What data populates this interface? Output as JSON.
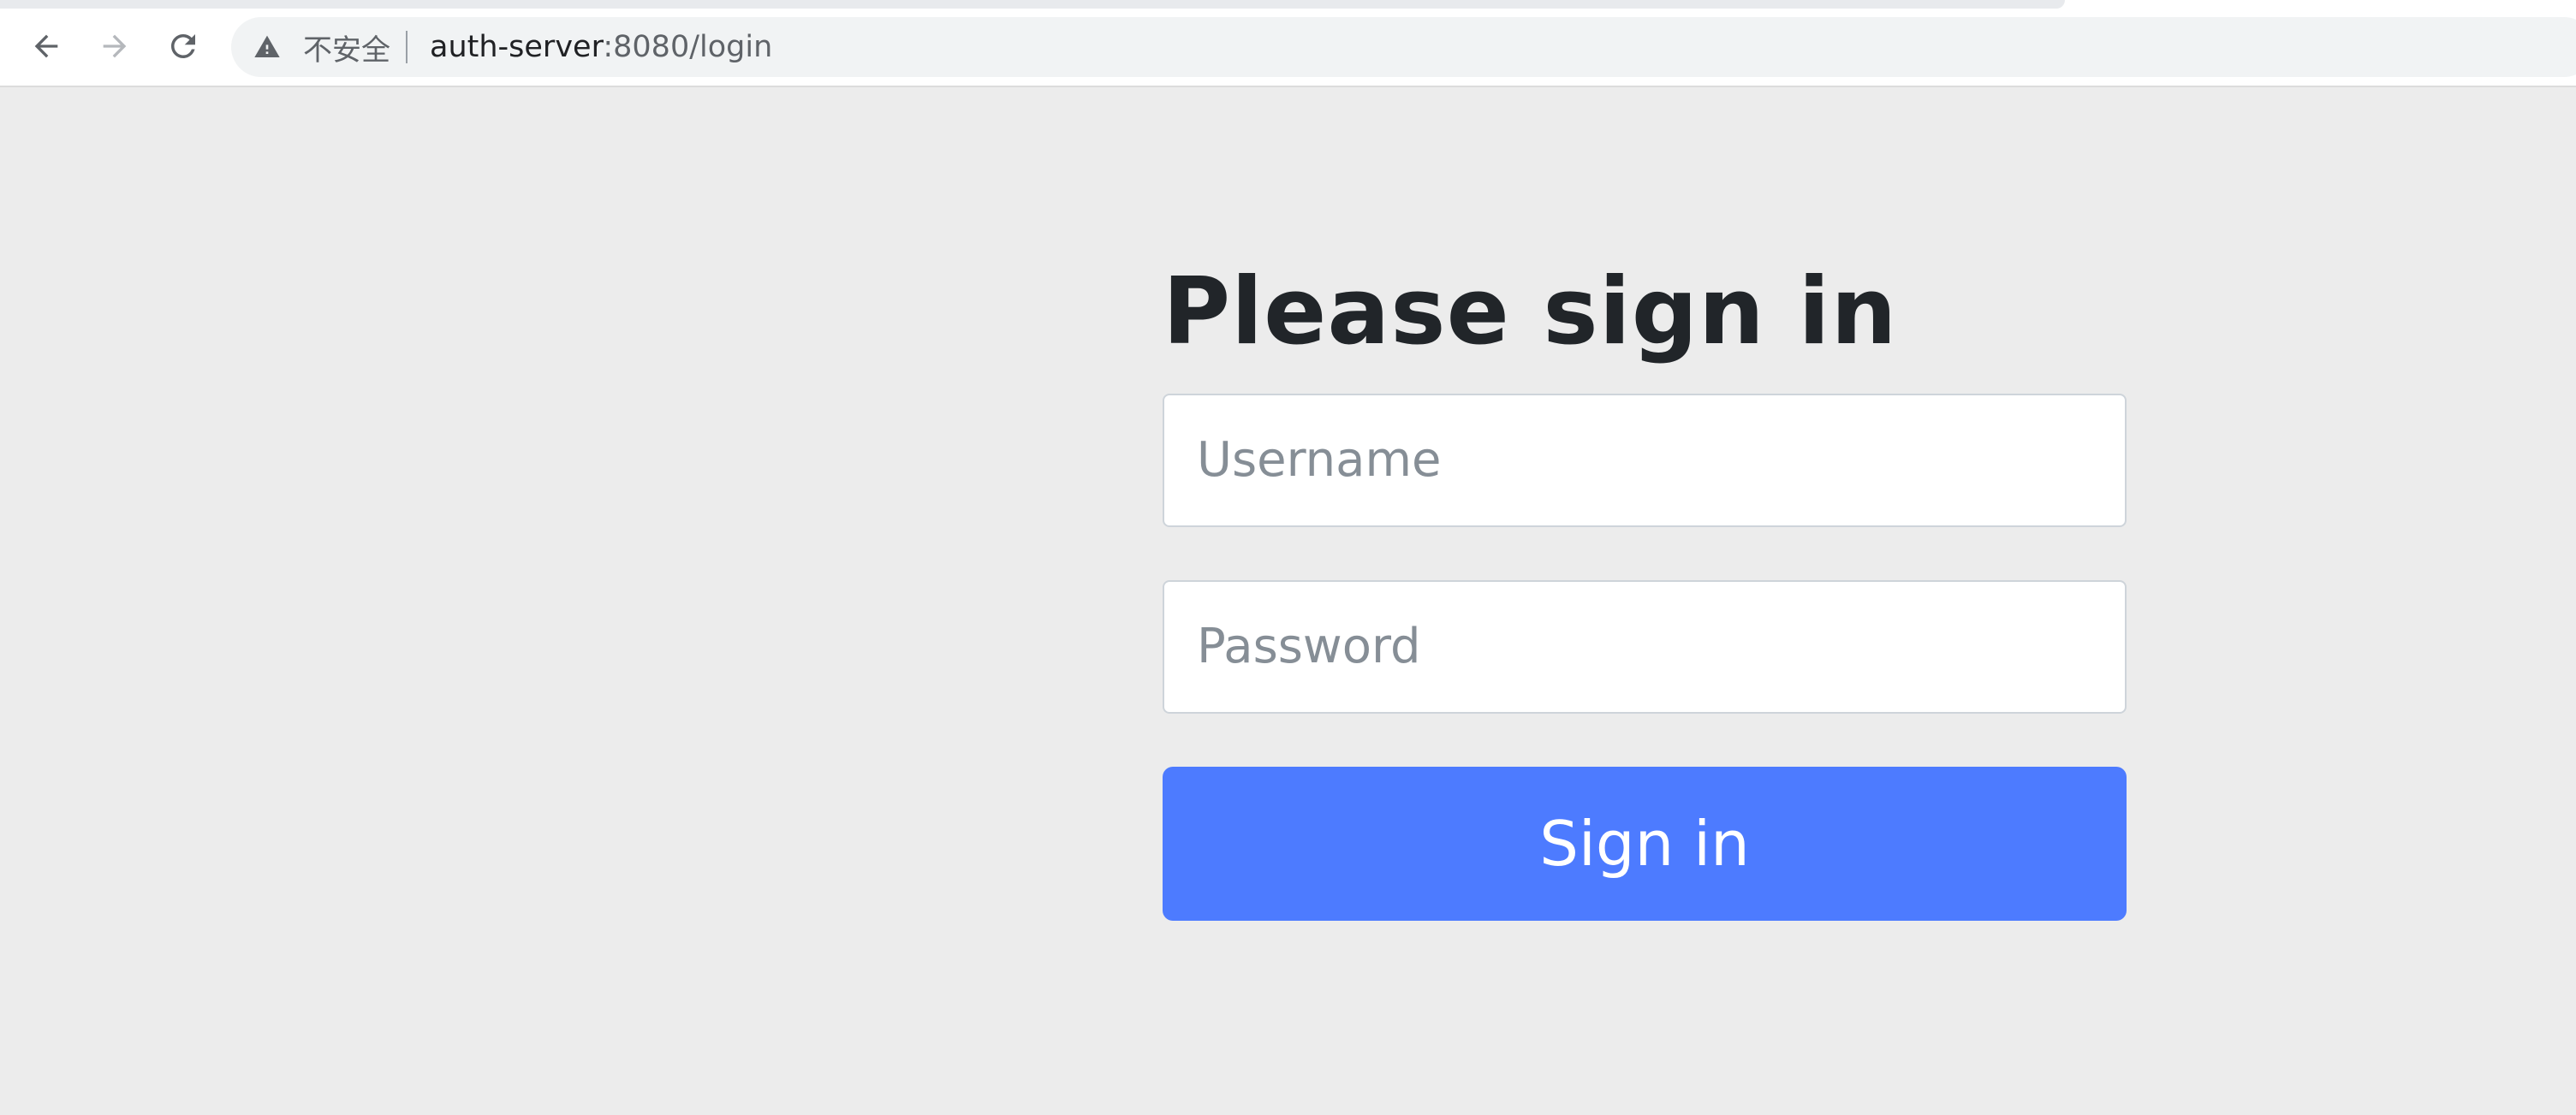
{
  "browser": {
    "security_label": "不安全",
    "url_host": "auth-server",
    "url_rest": ":8080/login",
    "icons": {
      "back": "arrow-left-icon",
      "forward": "arrow-right-icon",
      "reload": "reload-icon",
      "security": "warning-icon"
    }
  },
  "login": {
    "title": "Please sign in",
    "username_placeholder": "Username",
    "password_placeholder": "Password",
    "submit_label": "Sign in"
  },
  "colors": {
    "page_background": "#ececec",
    "primary_button": "#4d7bff",
    "title_text": "#212529",
    "placeholder_text": "#868e96"
  }
}
